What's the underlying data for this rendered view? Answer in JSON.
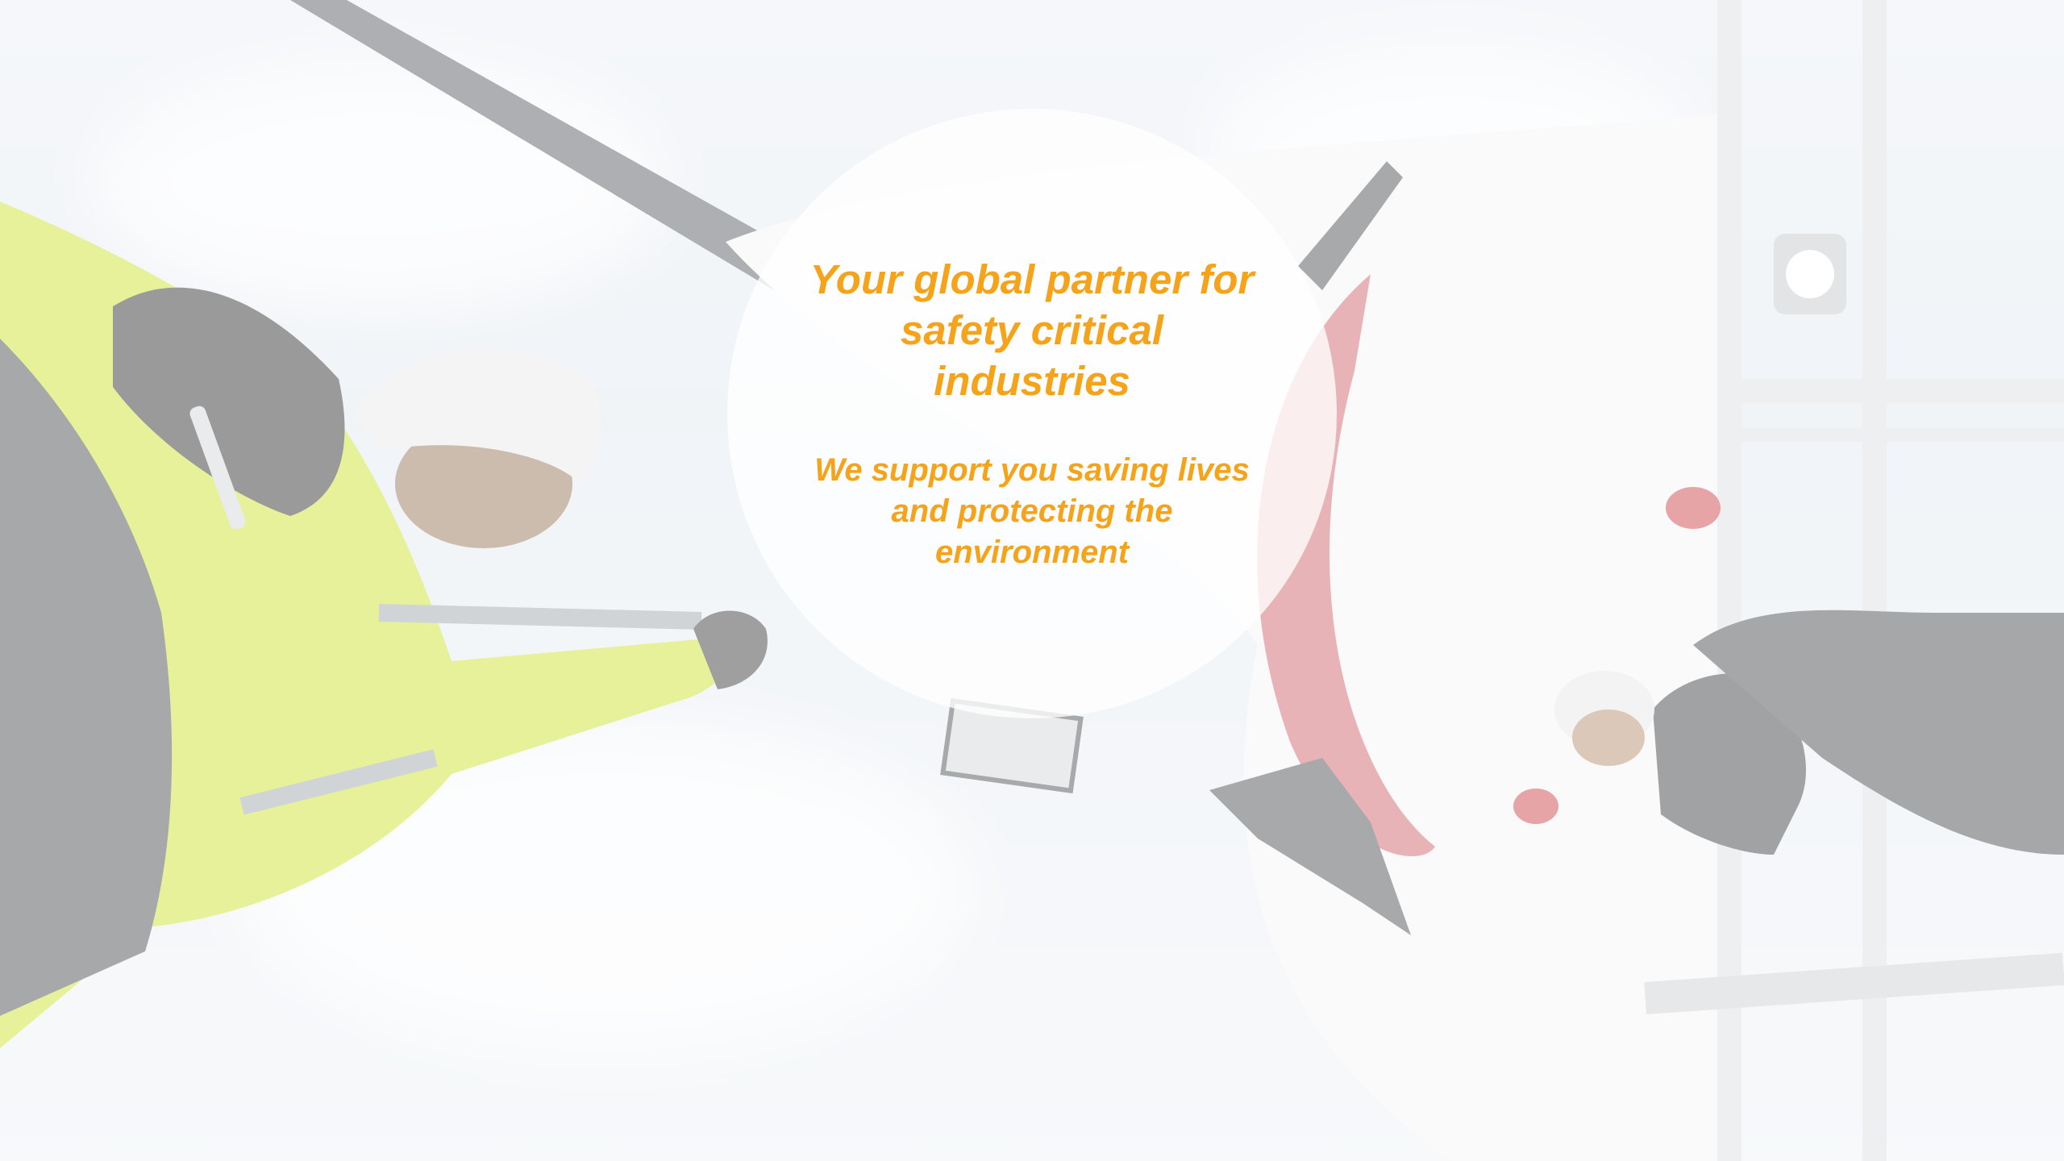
{
  "hero": {
    "background_image": "wind-turbine-technicians-photo",
    "headline": "Your global partner for safety critical industries",
    "subline": "We support you saving lives and protecting the environment",
    "accent_color": "#f5a31a"
  }
}
